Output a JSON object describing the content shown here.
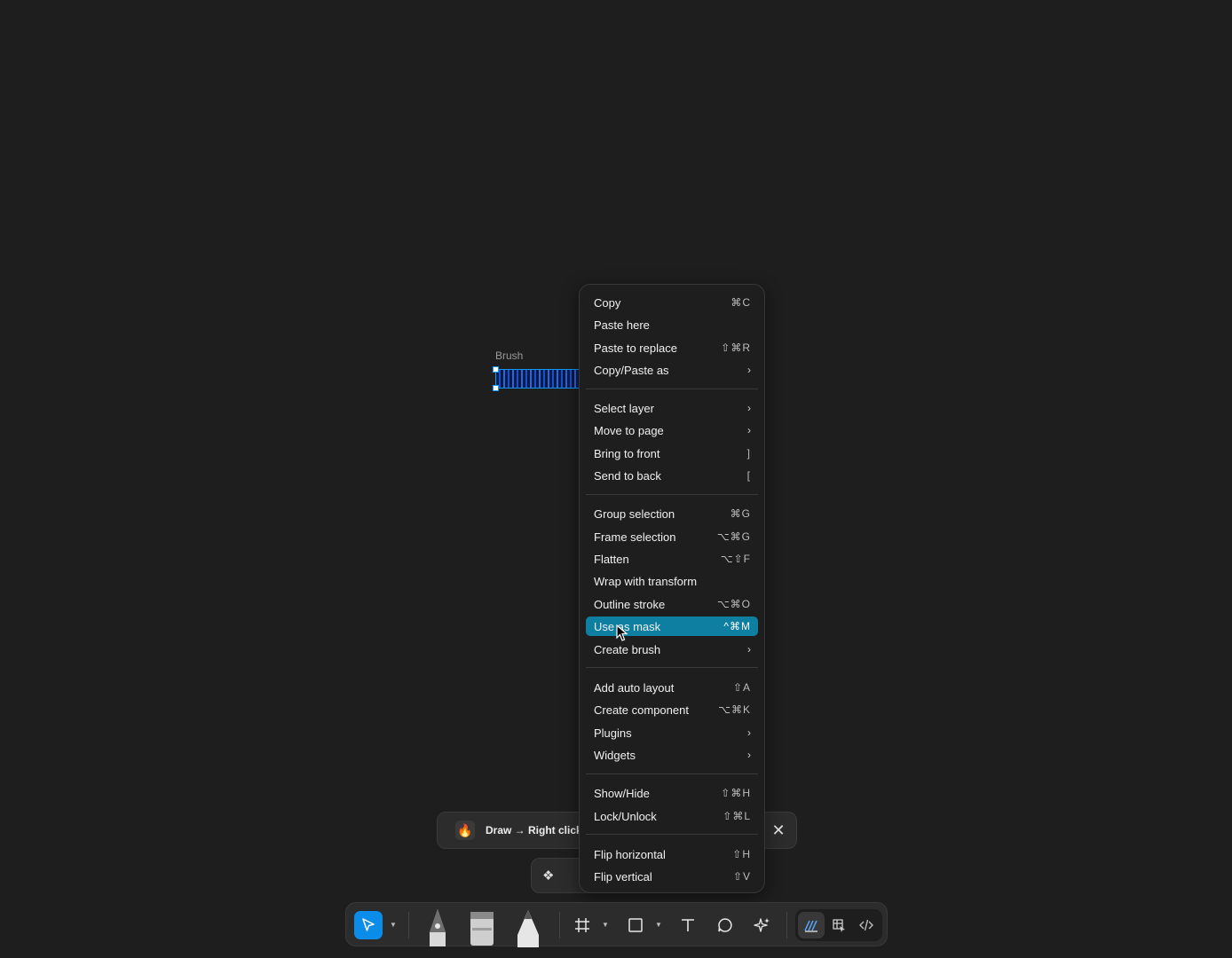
{
  "canvas": {
    "layer_label": "Brush"
  },
  "toast": {
    "text": "Draw → Right click",
    "close_glyph": "✕"
  },
  "context_menu": {
    "items": [
      {
        "label": "Copy",
        "shortcut": "⌘C",
        "submenu": false
      },
      {
        "label": "Paste here",
        "shortcut": "",
        "submenu": false
      },
      {
        "label": "Paste to replace",
        "shortcut": "⇧⌘R",
        "submenu": false
      },
      {
        "label": "Copy/Paste as",
        "shortcut": "",
        "submenu": true
      },
      {
        "label": "Select layer",
        "shortcut": "",
        "submenu": true
      },
      {
        "label": "Move to page",
        "shortcut": "",
        "submenu": true
      },
      {
        "label": "Bring to front",
        "shortcut": "]",
        "submenu": false
      },
      {
        "label": "Send to back",
        "shortcut": "[",
        "submenu": false
      },
      {
        "label": "Group selection",
        "shortcut": "⌘G",
        "submenu": false
      },
      {
        "label": "Frame selection",
        "shortcut": "⌥⌘G",
        "submenu": false
      },
      {
        "label": "Flatten",
        "shortcut": "⌥⇧F",
        "submenu": false
      },
      {
        "label": "Wrap with transform",
        "shortcut": "",
        "submenu": false
      },
      {
        "label": "Outline stroke",
        "shortcut": "⌥⌘O",
        "submenu": false
      },
      {
        "label": "Use as mask",
        "shortcut": "^⌘M",
        "submenu": false,
        "highlighted": true
      },
      {
        "label": "Create brush",
        "shortcut": "",
        "submenu": true
      },
      {
        "label": "Add auto layout",
        "shortcut": "⇧A",
        "submenu": false
      },
      {
        "label": "Create component",
        "shortcut": "⌥⌘K",
        "submenu": false
      },
      {
        "label": "Plugins",
        "shortcut": "",
        "submenu": true
      },
      {
        "label": "Widgets",
        "shortcut": "",
        "submenu": true
      },
      {
        "label": "Show/Hide",
        "shortcut": "⇧⌘H",
        "submenu": false
      },
      {
        "label": "Lock/Unlock",
        "shortcut": "⇧⌘L",
        "submenu": false
      },
      {
        "label": "Flip horizontal",
        "shortcut": "⇧H",
        "submenu": false
      },
      {
        "label": "Flip vertical",
        "shortcut": "⇧V",
        "submenu": false
      }
    ],
    "submenu_glyph": "›",
    "highlight_color": "#0e7ea1"
  },
  "toolbar": {
    "tools": [
      {
        "name": "move-tool",
        "icon": "cursor-arrow-icon",
        "selected": true
      },
      {
        "name": "pen-tool",
        "icon": "pen-nib-icon"
      },
      {
        "name": "marker-tool",
        "icon": "marker-icon"
      },
      {
        "name": "pencil-tool",
        "icon": "pencil-icon"
      },
      {
        "name": "frame-tool",
        "icon": "hash-frame-icon"
      },
      {
        "name": "shape-tool",
        "icon": "square-icon"
      },
      {
        "name": "text-tool",
        "icon": "text-icon"
      },
      {
        "name": "comment-tool",
        "icon": "comment-icon"
      },
      {
        "name": "ai-tool",
        "icon": "sparkle-icon"
      }
    ],
    "modes": [
      "draw-mode-icon",
      "design-mode-icon",
      "dev-mode-icon"
    ],
    "accent_color": "#0c8ce9"
  }
}
